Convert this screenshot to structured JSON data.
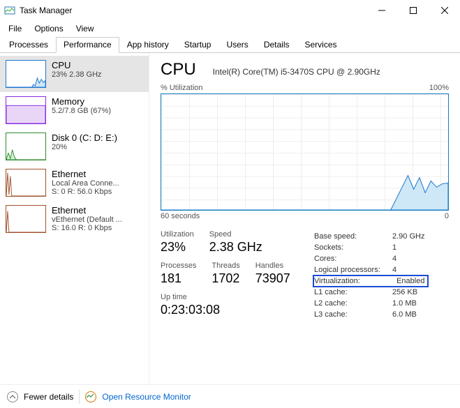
{
  "window": {
    "title": "Task Manager"
  },
  "menu": {
    "file": "File",
    "options": "Options",
    "view": "View"
  },
  "tabs": {
    "processes": "Processes",
    "performance": "Performance",
    "appHistory": "App history",
    "startup": "Startup",
    "users": "Users",
    "details": "Details",
    "services": "Services"
  },
  "sidebar": {
    "cpu": {
      "title": "CPU",
      "sub": "23%  2.38 GHz"
    },
    "mem": {
      "title": "Memory",
      "sub": "5.2/7.8 GB (67%)"
    },
    "disk": {
      "title": "Disk 0 (C: D: E:)",
      "sub": "20%"
    },
    "eth1": {
      "title": "Ethernet",
      "sub1": "Local Area Conne...",
      "sub2": "S: 0 R: 56.0 Kbps"
    },
    "eth2": {
      "title": "Ethernet",
      "sub1": "vEthernet (Default ...",
      "sub2": "S: 16.0 R: 0 Kbps"
    }
  },
  "main": {
    "title": "CPU",
    "subtitle": "Intel(R) Core(TM) i5-3470S CPU @ 2.90GHz",
    "chartTop": {
      "left": "% Utilization",
      "right": "100%"
    },
    "chartBottom": {
      "left": "60 seconds",
      "right": "0"
    },
    "statsLeft": {
      "utilization": {
        "lab": "Utilization",
        "val": "23%"
      },
      "speed": {
        "lab": "Speed",
        "val": "2.38 GHz"
      },
      "processes": {
        "lab": "Processes",
        "val": "181"
      },
      "threads": {
        "lab": "Threads",
        "val": "1702"
      },
      "handles": {
        "lab": "Handles",
        "val": "73907"
      },
      "uptime": {
        "lab": "Up time",
        "val": "0:23:03:08"
      }
    },
    "statsRight": {
      "baseSpeed": {
        "lab": "Base speed:",
        "val": "2.90 GHz"
      },
      "sockets": {
        "lab": "Sockets:",
        "val": "1"
      },
      "cores": {
        "lab": "Cores:",
        "val": "4"
      },
      "logical": {
        "lab": "Logical processors:",
        "val": "4"
      },
      "virtualization": {
        "lab": "Virtualization:",
        "val": "Enabled"
      },
      "l1": {
        "lab": "L1 cache:",
        "val": "256 KB"
      },
      "l2": {
        "lab": "L2 cache:",
        "val": "1.0 MB"
      },
      "l3": {
        "lab": "L3 cache:",
        "val": "6.0 MB"
      }
    }
  },
  "footer": {
    "fewer": "Fewer details",
    "orm": "Open Resource Monitor"
  },
  "chart_data": {
    "type": "line",
    "title": "% Utilization",
    "xlabel": "60 seconds → 0",
    "ylabel": "%",
    "ylim": [
      0,
      100
    ],
    "x_seconds_ago": [
      60,
      55,
      50,
      45,
      40,
      35,
      30,
      25,
      20,
      15,
      10,
      8,
      6,
      5,
      4,
      3,
      2,
      1,
      0
    ],
    "values": [
      0,
      0,
      0,
      0,
      0,
      0,
      0,
      0,
      0,
      0,
      0,
      15,
      30,
      18,
      28,
      15,
      25,
      20,
      23
    ]
  }
}
